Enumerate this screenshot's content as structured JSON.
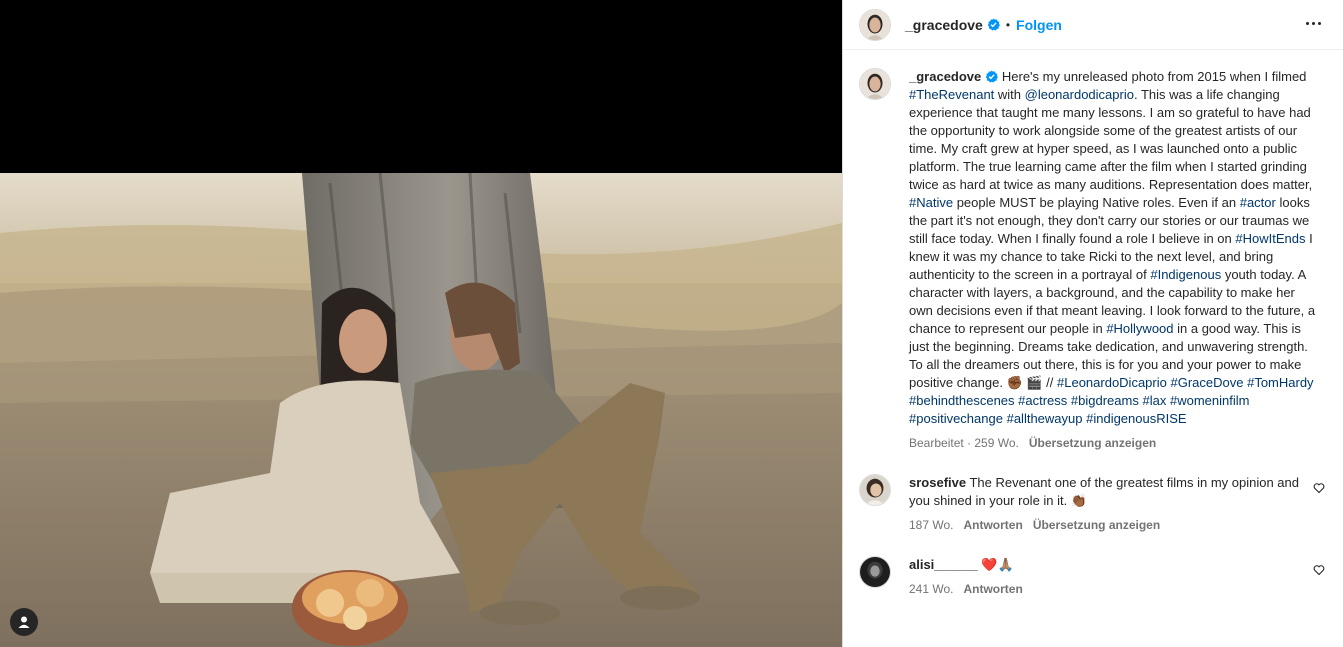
{
  "post": {
    "username": "_gracedove",
    "follow_label": "Folgen",
    "separator": "•"
  },
  "caption": {
    "username": "_gracedove",
    "parts": [
      {
        "t": "text",
        "v": " Here's my unreleased photo from 2015 when I filmed "
      },
      {
        "t": "tag",
        "v": "#TheRevenant"
      },
      {
        "t": "text",
        "v": " with "
      },
      {
        "t": "tag",
        "v": "@leonardodicaprio"
      },
      {
        "t": "text",
        "v": ". This was a life changing experience that taught me many lessons. I am so grateful to have had the opportunity to work alongside some of the greatest artists of our time. My craft grew at hyper speed, as I was launched onto a public platform. The true learning came after the film when I started grinding twice as hard at twice as many auditions. Representation does matter, "
      },
      {
        "t": "tag",
        "v": "#Native"
      },
      {
        "t": "text",
        "v": " people MUST be playing Native roles. Even if an "
      },
      {
        "t": "tag",
        "v": "#actor"
      },
      {
        "t": "text",
        "v": " looks the part it's not enough, they don't carry our stories or our traumas we still face today. When I finally found a role I believe in on "
      },
      {
        "t": "tag",
        "v": "#HowItEnds"
      },
      {
        "t": "text",
        "v": " I knew it was my chance to take Ricki to the next level, and bring authenticity to the screen in a portrayal of "
      },
      {
        "t": "tag",
        "v": "#Indigenous"
      },
      {
        "t": "text",
        "v": " youth today. A character with layers, a background, and the capability to make her own decisions even if that meant leaving. I look forward to the future, a chance to represent our people in "
      },
      {
        "t": "tag",
        "v": "#Hollywood"
      },
      {
        "t": "text",
        "v": " in a good way. This is just the beginning. Dreams take dedication, and unwavering strength. To all the dreamers out there, this is for you and your power to make positive change. ✊🏾 🎬 // "
      },
      {
        "t": "tag",
        "v": "#LeonardoDicaprio"
      },
      {
        "t": "text",
        "v": " "
      },
      {
        "t": "tag",
        "v": "#GraceDove"
      },
      {
        "t": "text",
        "v": " "
      },
      {
        "t": "tag",
        "v": "#TomHardy"
      },
      {
        "t": "text",
        "v": " "
      },
      {
        "t": "tag",
        "v": "#behindthescenes"
      },
      {
        "t": "text",
        "v": " "
      },
      {
        "t": "tag",
        "v": "#actress"
      },
      {
        "t": "text",
        "v": " "
      },
      {
        "t": "tag",
        "v": "#bigdreams"
      },
      {
        "t": "text",
        "v": " "
      },
      {
        "t": "tag",
        "v": "#lax"
      },
      {
        "t": "text",
        "v": " "
      },
      {
        "t": "tag",
        "v": "#womeninfilm"
      },
      {
        "t": "text",
        "v": " "
      },
      {
        "t": "tag",
        "v": "#positivechange"
      },
      {
        "t": "text",
        "v": " "
      },
      {
        "t": "tag",
        "v": "#allthewayup"
      },
      {
        "t": "text",
        "v": " "
      },
      {
        "t": "tag",
        "v": "#indigenousRISE"
      }
    ],
    "edited": "Bearbeitet · 259 Wo.",
    "translate": "Übersetzung anzeigen"
  },
  "comments": [
    {
      "username": "srosefive",
      "text": " The Revenant one of the greatest films in my opinion and you shined in your role in it. 👏🏾",
      "age": "187 Wo.",
      "reply": "Antworten",
      "translate": "Übersetzung anzeigen"
    },
    {
      "username": "alisi______",
      "text": " ❤️🙏🏽",
      "age": "241 Wo.",
      "reply": "Antworten"
    }
  ],
  "icons": {
    "verified": "verified-badge-icon",
    "more": "more-options-icon",
    "heart": "heart-outline-icon",
    "tag_user": "person-tag-icon"
  },
  "colors": {
    "accent": "#0095f6",
    "hashtag": "#00376b",
    "muted": "#737373"
  }
}
